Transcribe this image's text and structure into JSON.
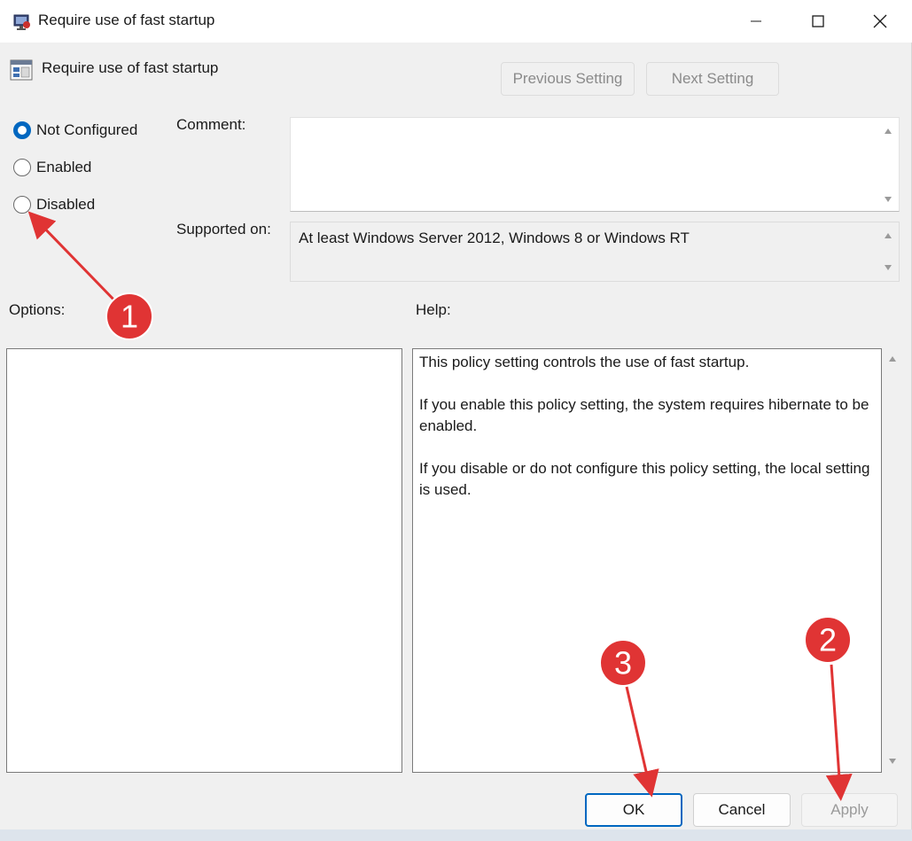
{
  "window": {
    "title": "Require use of fast startup",
    "controls": [
      "minimize",
      "maximize",
      "close"
    ]
  },
  "header": {
    "policy_title": "Require use of fast startup",
    "prev_label": "Previous Setting",
    "next_label": "Next Setting"
  },
  "state": {
    "options": [
      {
        "label": "Not Configured",
        "checked": true
      },
      {
        "label": "Enabled",
        "checked": false
      },
      {
        "label": "Disabled",
        "checked": false
      }
    ]
  },
  "comment": {
    "label": "Comment:",
    "value": ""
  },
  "supported": {
    "label": "Supported on:",
    "value": "At least Windows Server 2012, Windows 8 or Windows RT"
  },
  "options_pane": {
    "label": "Options:"
  },
  "help_pane": {
    "label": "Help:",
    "paragraphs": [
      "This policy setting controls the use of fast startup.",
      "If you enable this policy setting, the system requires hibernate to be enabled.",
      "If you disable or do not configure this policy setting, the local setting is used."
    ]
  },
  "footer": {
    "ok_label": "OK",
    "cancel_label": "Cancel",
    "apply_label": "Apply"
  },
  "annotations": {
    "callouts": [
      "1",
      "2",
      "3"
    ],
    "color": "#e03434"
  },
  "colors": {
    "accent": "#0067c0",
    "callout": "#e03434"
  }
}
